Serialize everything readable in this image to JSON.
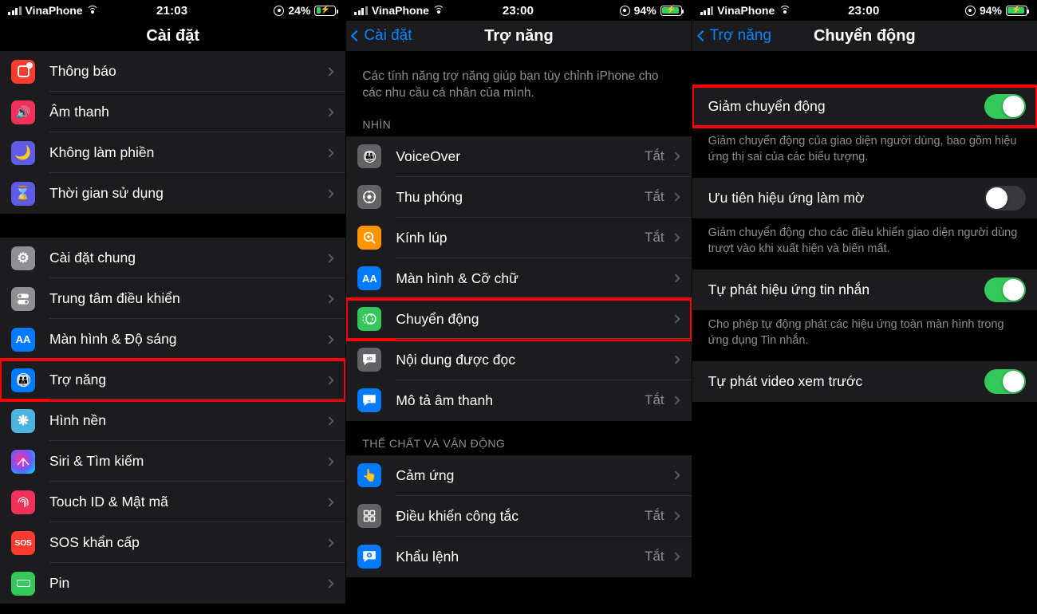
{
  "panels": [
    {
      "status": {
        "carrier": "VinaPhone",
        "time": "21:03",
        "battery": "24%",
        "signal_icon": "signal-bars-icon",
        "wifi_icon": "wifi-icon",
        "lock_icon": "rotation-lock-icon",
        "battery_icon": "battery-charging-icon"
      },
      "nav": {
        "title": "Cài đặt",
        "back": null
      },
      "groups": [
        {
          "rows": [
            {
              "label": "Thông báo",
              "icon": "notifications-icon",
              "icon_color": "#ff3b30",
              "value": "",
              "chevron": true
            },
            {
              "label": "Âm thanh",
              "icon": "sounds-icon",
              "icon_color": "#f0325a",
              "value": "",
              "chevron": true
            },
            {
              "label": "Không làm phiền",
              "icon": "do-not-disturb-icon",
              "icon_color": "#5e5ce6",
              "value": "",
              "chevron": true
            },
            {
              "label": "Thời gian sử dụng",
              "icon": "screen-time-icon",
              "icon_color": "#5e5ce6",
              "value": "",
              "chevron": true
            }
          ]
        },
        {
          "rows": [
            {
              "label": "Cài đặt chung",
              "icon": "gear-icon",
              "icon_color": "#8e8e93",
              "value": "",
              "chevron": true
            },
            {
              "label": "Trung tâm điều khiển",
              "icon": "control-center-icon",
              "icon_color": "#8e8e93",
              "value": "",
              "chevron": true
            },
            {
              "label": "Màn hình & Độ sáng",
              "icon": "display-brightness-icon",
              "icon_color": "#007aff",
              "value": "",
              "chevron": true
            },
            {
              "label": "Trợ năng",
              "icon": "accessibility-icon",
              "icon_color": "#007aff",
              "value": "",
              "chevron": true,
              "highlight": true
            },
            {
              "label": "Hình nền",
              "icon": "wallpaper-icon",
              "icon_color": "#4bb3dd",
              "value": "",
              "chevron": true
            },
            {
              "label": "Siri & Tìm kiếm",
              "icon": "siri-icon",
              "icon_color": "#2a2a3a",
              "value": "",
              "chevron": true
            },
            {
              "label": "Touch ID & Mật mã",
              "icon": "touch-id-icon",
              "icon_color": "#f0325a",
              "value": "",
              "chevron": true
            },
            {
              "label": "SOS khẩn cấp",
              "icon": "sos-icon",
              "icon_color": "#ff3b30",
              "value": "",
              "chevron": true
            },
            {
              "label": "Pin",
              "icon": "battery-icon",
              "icon_color": "#34c759",
              "value": "",
              "chevron": true
            }
          ]
        }
      ]
    },
    {
      "status": {
        "carrier": "VinaPhone",
        "time": "23:00",
        "battery": "94%",
        "signal_icon": "signal-bars-icon",
        "wifi_icon": "wifi-icon",
        "lock_icon": "rotation-lock-icon",
        "battery_icon": "battery-charging-icon"
      },
      "nav": {
        "title": "Trợ năng",
        "back": "Cài đặt"
      },
      "intro": "Các tính năng trợ năng giúp bạn tùy chỉnh iPhone cho các nhu cầu cá nhân của mình.",
      "section1_title": "NHÌN",
      "section2_title": "THỂ CHẤT VÀ VẬN ĐỘNG",
      "groups": [
        {
          "rows": [
            {
              "label": "VoiceOver",
              "icon": "voiceover-icon",
              "icon_color": "#636366",
              "value": "Tắt",
              "chevron": true
            },
            {
              "label": "Thu phóng",
              "icon": "zoom-icon",
              "icon_color": "#636366",
              "value": "Tắt",
              "chevron": true
            },
            {
              "label": "Kính lúp",
              "icon": "magnifier-icon",
              "icon_color": "#ff9500",
              "value": "Tắt",
              "chevron": true
            },
            {
              "label": "Màn hình & Cỡ chữ",
              "icon": "display-text-size-icon",
              "icon_color": "#007aff",
              "value": "",
              "chevron": true
            },
            {
              "label": "Chuyển động",
              "icon": "motion-icon",
              "icon_color": "#34c759",
              "value": "",
              "chevron": true,
              "highlight": true
            },
            {
              "label": "Nội dung được đọc",
              "icon": "spoken-content-icon",
              "icon_color": "#636366",
              "value": "",
              "chevron": true
            },
            {
              "label": "Mô tả âm thanh",
              "icon": "audio-descriptions-icon",
              "icon_color": "#007aff",
              "value": "Tắt",
              "chevron": true
            }
          ]
        },
        {
          "rows": [
            {
              "label": "Cảm ứng",
              "icon": "touch-icon",
              "icon_color": "#007aff",
              "value": "",
              "chevron": true
            },
            {
              "label": "Điều khiển công tắc",
              "icon": "switch-control-icon",
              "icon_color": "#636366",
              "value": "Tắt",
              "chevron": true
            },
            {
              "label": "Khẩu lệnh",
              "icon": "voice-control-icon",
              "icon_color": "#007aff",
              "value": "Tắt",
              "chevron": true
            }
          ]
        }
      ]
    },
    {
      "status": {
        "carrier": "VinaPhone",
        "time": "23:00",
        "battery": "94%",
        "signal_icon": "signal-bars-icon",
        "wifi_icon": "wifi-icon",
        "lock_icon": "rotation-lock-icon",
        "battery_icon": "battery-charging-icon"
      },
      "nav": {
        "title": "Chuyển động",
        "back": "Trợ năng"
      },
      "toggles": [
        {
          "label": "Giảm chuyển động",
          "state": "on",
          "highlight": true,
          "footnote": "Giảm chuyển động của giao diện người dùng, bao gồm hiệu ứng thị sai của các biểu tượng."
        },
        {
          "label": "Ưu tiên hiệu ứng làm mờ",
          "state": "off",
          "highlight": false,
          "footnote": "Giảm chuyển động cho các điều khiển giao diện người dùng trượt vào khi xuất hiện và biến mất."
        },
        {
          "label": "Tự phát hiệu ứng tin nhắn",
          "state": "on",
          "highlight": false,
          "footnote": "Cho phép tự động phát các hiệu ứng toàn màn hình trong ứng dụng Tin nhắn."
        },
        {
          "label": "Tự phát video xem trước",
          "state": "on",
          "highlight": false,
          "footnote": ""
        }
      ]
    }
  ],
  "colors": {
    "accent": "#0a84ff",
    "toggle_on": "#34c759",
    "toggle_off": "#39393d",
    "highlight": "#ff0000",
    "row_bg": "#1c1c1e",
    "page_bg": "#000000",
    "secondary_text": "#8e8e93"
  }
}
